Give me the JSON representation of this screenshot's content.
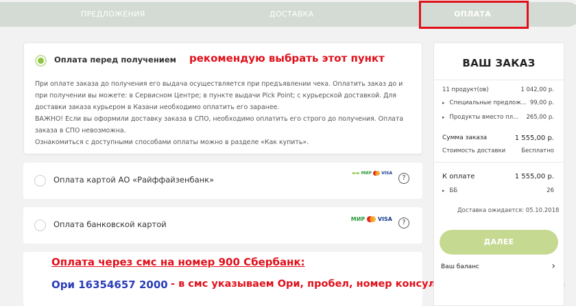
{
  "tabs": [
    {
      "label": "ПРЕДЛОЖЕНИЯ"
    },
    {
      "label": "ДОСТАВКА"
    },
    {
      "label": "ОПЛАТА"
    }
  ],
  "colors": {
    "accent_green": "#8dc63f",
    "annotation_red": "#e10f1a",
    "annotation_blue": "#2a3cb8",
    "button_green": "#c5d991"
  },
  "payment": {
    "option1": {
      "title": "Оплата перед получением",
      "selected": true,
      "annotation": "рекомендую выбрать этот пункт",
      "description": [
        "При оплате заказа до получения его выдача осуществляется при предъявлении чека. Оплатить заказ до и",
        "при получении вы можете: в Сервисном Центре; в пункте выдачи Pick Point; с курьерской доставкой. Для",
        "доставки заказа курьером в Казани необходимо оплатить его заранее.",
        "ВАЖНО! Если вы оформили доставку заказа в СПО, необходимо оплатить его строго до получения. Оплата",
        "заказа в СПО невозможна.",
        "Ознакомиться с доступными способами оплаты можно в разделе «Как купить»."
      ]
    },
    "option2": {
      "title": "Оплата картой АО «Райффайзенбанк»",
      "logos": {
        "extra": "▬▬",
        "mir": "МИР",
        "visa": "VISA"
      },
      "help": "?"
    },
    "option3": {
      "title": "Оплата банковской картой",
      "logos": {
        "mir": "МИР",
        "visa": "VISA"
      },
      "help": "?"
    },
    "sms": {
      "heading": "Оплата через смс на номер 900 Сбербанк:",
      "code": "Ори 16354657 2000",
      "hint": "- в смс указываем Ори, пробел, номер консультанта, пробел, сумма"
    }
  },
  "order": {
    "title": "ВАШ ЗАКАЗ",
    "rows": [
      {
        "label": "11 продукт(ов)",
        "value": "1 042,00 р."
      },
      {
        "label": "Специальные предлож...",
        "value": "99,00 р."
      },
      {
        "label": "Продукты вместо пл...",
        "value": "265,00 р."
      },
      {
        "label": "Сумма заказа",
        "value": "1 555,00 р."
      },
      {
        "label": "Стоимость доставки",
        "value": "Бесплатно"
      },
      {
        "label": "К оплате",
        "value": "1 555,00 р."
      },
      {
        "label": "ББ",
        "value": "26"
      }
    ],
    "delivery_wait": "Доставка ожидается: 05.10.2018",
    "next_button": "ДАЛЕЕ",
    "balance": "Ваш баланс",
    "balance_chevron": "›"
  }
}
